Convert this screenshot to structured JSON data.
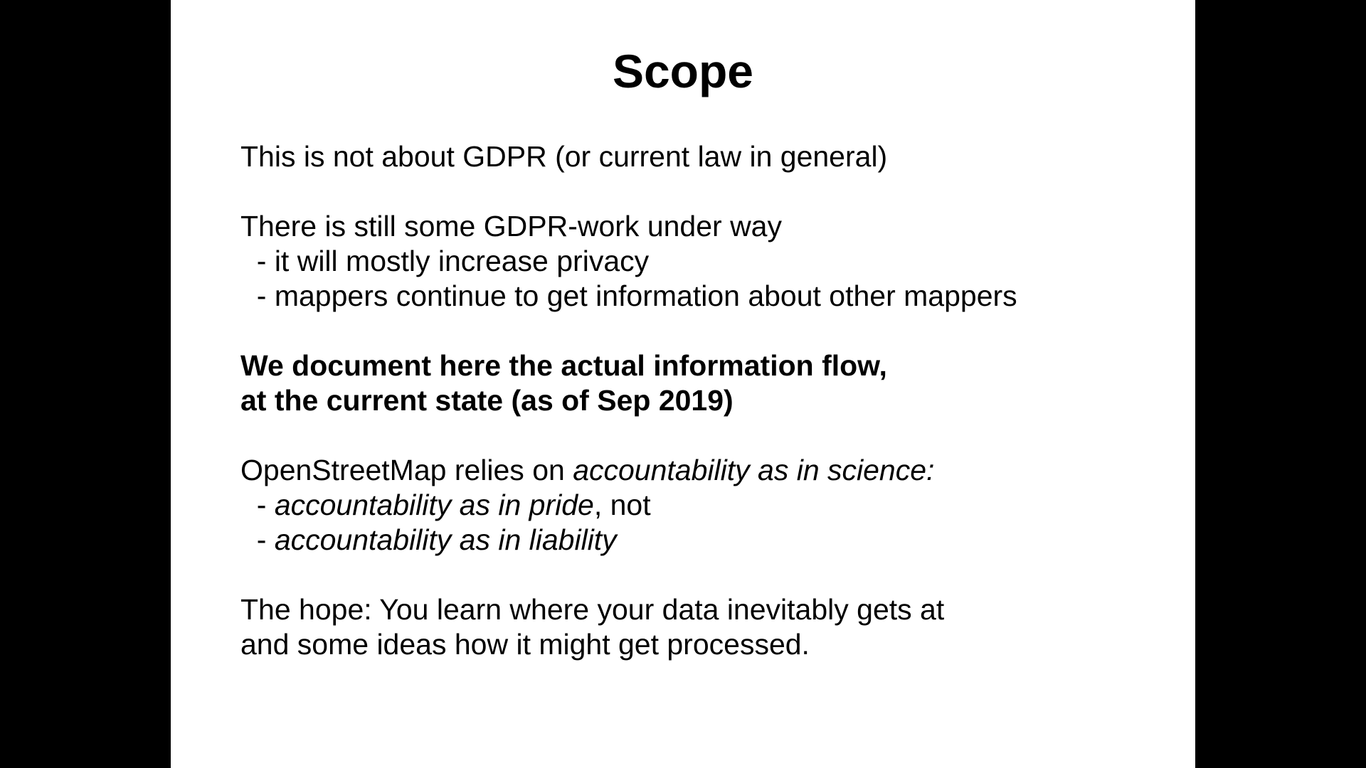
{
  "slide": {
    "title": "Scope",
    "p1": {
      "line1": "This is not about GDPR (or current law in general)"
    },
    "p2": {
      "line1": "There is still some GDPR-work under way",
      "line2": "  - it will mostly increase privacy",
      "line3": "  - mappers continue to get information about other mappers"
    },
    "p3": {
      "line1": "We document here the actual information flow,",
      "line2": "at the current state (as of Sep 2019)"
    },
    "p4": {
      "line1_plain": "OpenStreetMap relies on ",
      "line1_italic": "accountability as in science:",
      "line2_prefix": "  - ",
      "line2_italic": "accountability as in pride",
      "line2_plain": ", not",
      "line3_prefix": "  - ",
      "line3_italic": "accountability as in liability"
    },
    "p5": {
      "line1": "The hope: You learn where your data inevitably gets at",
      "line2": "and some ideas how it might get processed."
    }
  }
}
